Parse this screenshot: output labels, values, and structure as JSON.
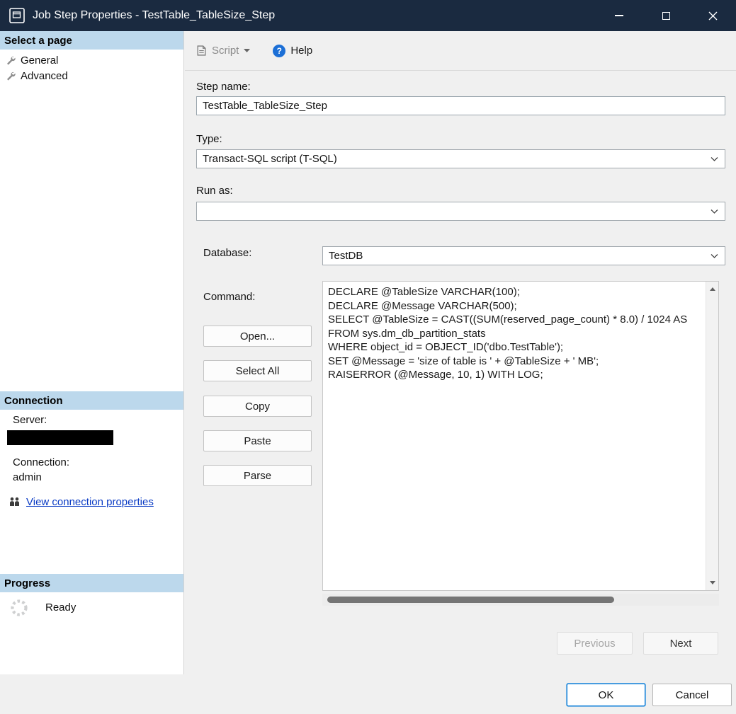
{
  "colors": {
    "titlebar": "#1a2a40",
    "section_header_blue": "#bcd8ec",
    "link_blue": "#0a3bc4",
    "focus_blue": "#0078d7",
    "help_icon_blue": "#1c6fd6",
    "dialog_bg": "#f0f0f0"
  },
  "window": {
    "title": "Job Step Properties - TestTable_TableSize_Step"
  },
  "sidebar": {
    "select_page_header": "Select a page",
    "pages": [
      {
        "label": "General"
      },
      {
        "label": "Advanced"
      }
    ],
    "connection": {
      "header": "Connection",
      "server_label": "Server:",
      "connection_label": "Connection:",
      "connection_value": "admin",
      "view_link": "View connection properties"
    },
    "progress": {
      "header": "Progress",
      "status": "Ready"
    }
  },
  "toolbar": {
    "script_label": "Script",
    "help_label": "Help",
    "help_glyph": "?"
  },
  "form": {
    "step_name_label": "Step name:",
    "step_name_value": "TestTable_TableSize_Step",
    "type_label": "Type:",
    "type_value": "Transact-SQL script (T-SQL)",
    "run_as_label": "Run as:",
    "run_as_value": "",
    "database_label": "Database:",
    "database_value": "TestDB",
    "command_label": "Command:",
    "open_label": "Open...",
    "select_all_label": "Select All",
    "copy_label": "Copy",
    "paste_label": "Paste",
    "parse_label": "Parse",
    "command_text": "DECLARE @TableSize VARCHAR(100);\nDECLARE @Message VARCHAR(500);\nSELECT @TableSize = CAST((SUM(reserved_page_count) * 8.0) / 1024 AS\nFROM sys.dm_db_partition_stats\nWHERE object_id = OBJECT_ID('dbo.TestTable');\nSET @Message = 'size of table is ' + @TableSize + ' MB';\nRAISERROR (@Message, 10, 1) WITH LOG;"
  },
  "navigation": {
    "previous_label": "Previous",
    "next_label": "Next"
  },
  "footer": {
    "ok_label": "OK",
    "cancel_label": "Cancel"
  }
}
